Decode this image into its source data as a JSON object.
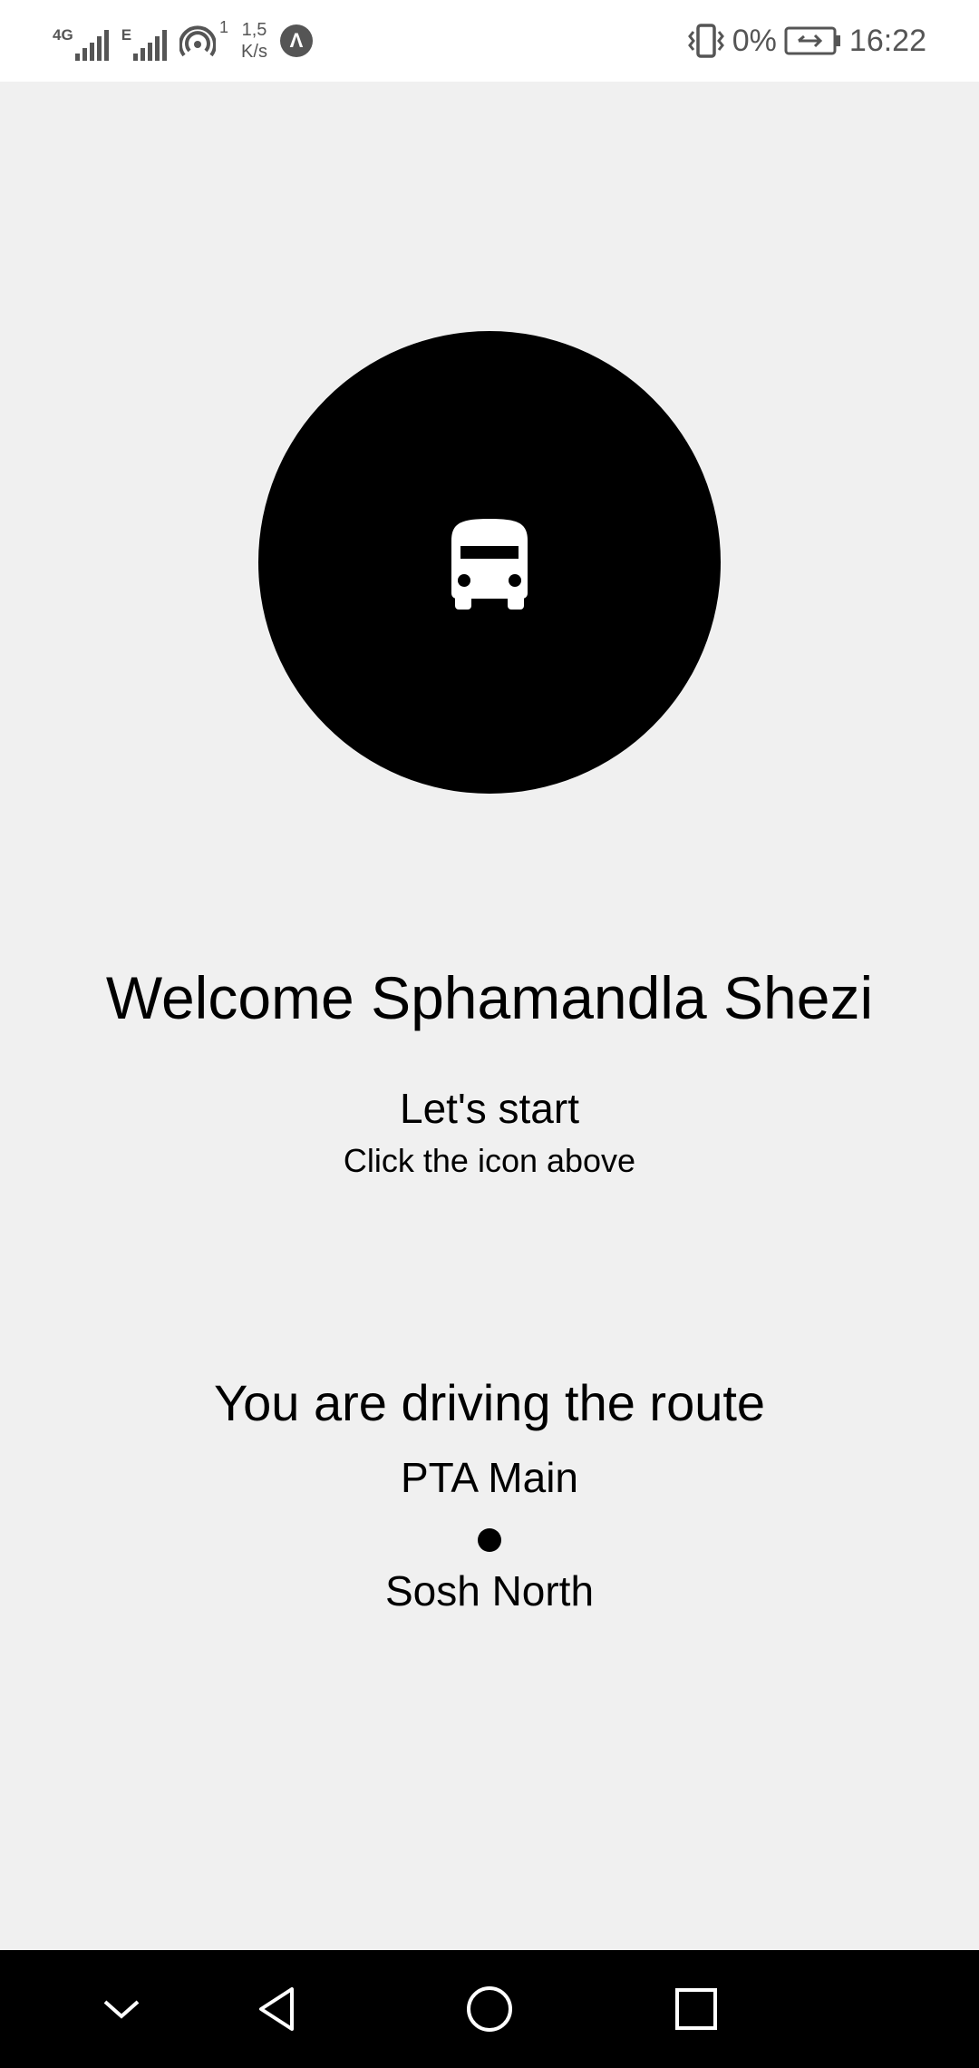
{
  "status_bar": {
    "network_1_label": "4G",
    "network_2_label": "E",
    "hotspot_count": "1",
    "speed_value": "1,5",
    "speed_unit": "K/s",
    "badge_letter": "Λ",
    "battery_percent": "0%",
    "time": "16:22"
  },
  "main": {
    "bus_button_icon": "bus-icon",
    "welcome": "Welcome Sphamandla Shezi",
    "lets_start": "Let's start",
    "instruction": "Click the icon above",
    "driving_label": "You are driving the route",
    "route_from": "PTA Main",
    "route_to": "Sosh North"
  },
  "nav_bar": {
    "buttons": [
      "chevron-down-icon",
      "back-icon",
      "home-icon",
      "recents-icon"
    ]
  },
  "colors": {
    "background": "#f0f0f0",
    "circle": "#000000",
    "status_bar": "#ffffff",
    "nav_bar": "#000000"
  }
}
